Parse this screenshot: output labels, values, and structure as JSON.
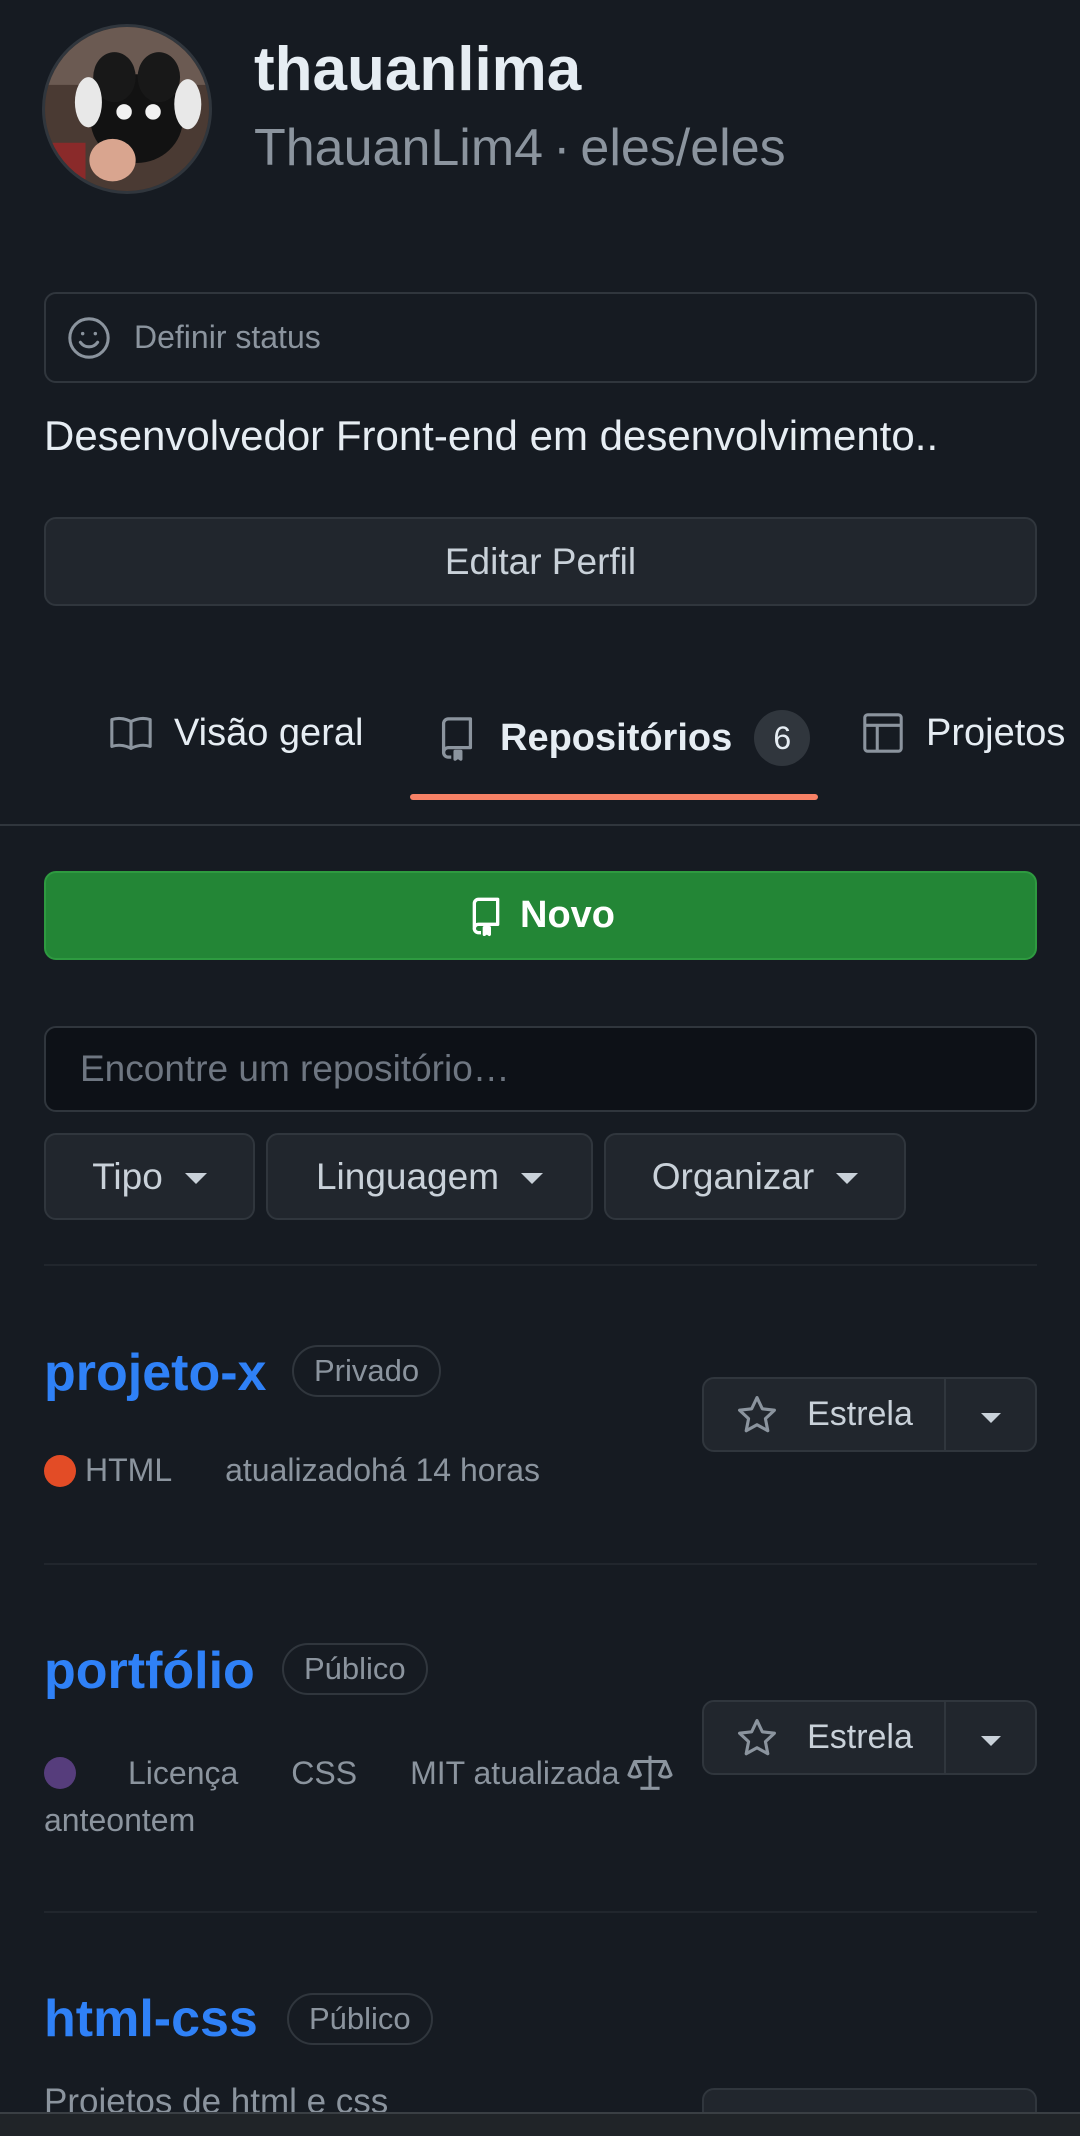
{
  "profile": {
    "username": "thauanlima",
    "handle": "ThauanLim4",
    "separator": "·",
    "pronouns": "eles/eles",
    "status_placeholder": "Definir status",
    "bio": "Desenvolvedor Front-end em desenvolvimento..",
    "edit_label": "Editar Perfil"
  },
  "tabs": [
    {
      "label": "Visão geral",
      "icon": "book-icon"
    },
    {
      "label": "Repositórios",
      "icon": "repo-icon",
      "count": "6"
    },
    {
      "label": "Projetos",
      "icon": "table-icon"
    }
  ],
  "actions": {
    "new_label": "Novo",
    "search_placeholder": "Encontre um repositório…",
    "filters": [
      "Tipo",
      "Linguagem",
      "Organizar"
    ]
  },
  "repos": [
    {
      "name": "projeto-x",
      "visibility": "Privado",
      "language": "HTML",
      "language_color": "#e34c26",
      "updated": "atualizadohá 14 horas",
      "star_label": "Estrela"
    },
    {
      "name": "portfólio",
      "visibility": "Público",
      "language_color": "#563d7c",
      "meta_words": [
        "Licença",
        "CSS",
        "MIT atualizada"
      ],
      "updated": "anteontem",
      "star_label": "Estrela"
    },
    {
      "name": "html-css",
      "visibility": "Público",
      "description": "Projetos de html e css"
    }
  ],
  "colors": {
    "background": "#161b22",
    "link": "#2f81f7",
    "primary_button": "#238636",
    "tab_underline": "#f78166"
  }
}
